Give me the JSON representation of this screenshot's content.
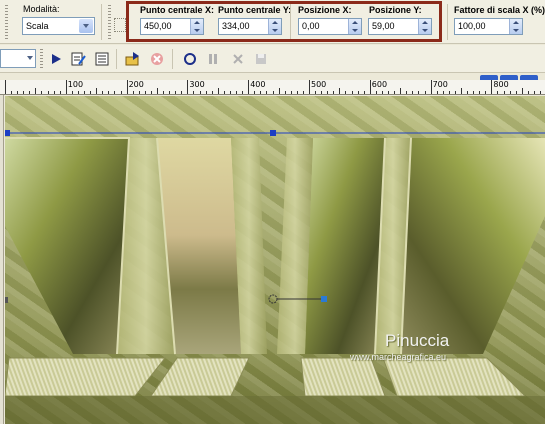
{
  "options": {
    "mode_label": "Modalità:",
    "mode_value": "Scala",
    "center_x_label": "Punto centrale X:",
    "center_x_value": "450,00",
    "center_y_label": "Punto centrale Y:",
    "center_y_value": "334,00",
    "pos_x_label": "Posizione X:",
    "pos_x_value": "0,00",
    "pos_y_label": "Posizione Y:",
    "pos_y_value": "59,00",
    "scale_x_label": "Fattore di scala X (%)",
    "scale_x_value": "100,00"
  },
  "ruler": {
    "labels": [
      "100",
      "200",
      "300",
      "400",
      "500",
      "600",
      "700",
      "800"
    ]
  },
  "canvas": {
    "watermark_name": "Pinuccia",
    "watermark_site": "www.marcheagrafica.eu"
  },
  "colors": {
    "highlight": "#8b2a1a",
    "handle": "#1d3fc4"
  }
}
